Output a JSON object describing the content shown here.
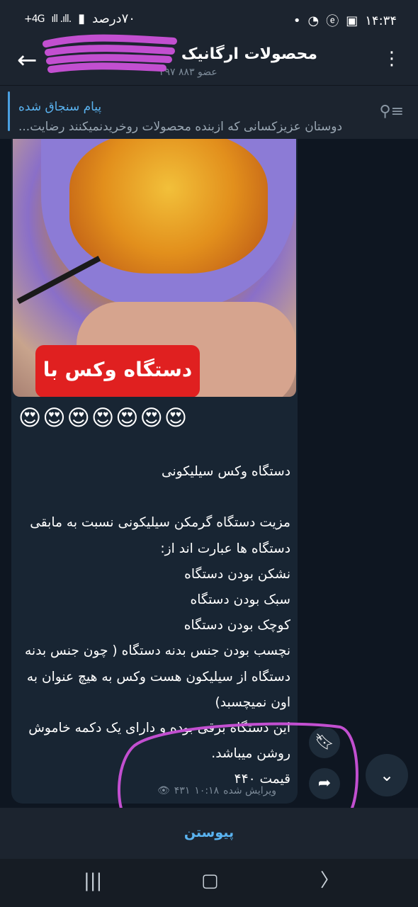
{
  "status_bar": {
    "time": "۱۴:۳۴",
    "battery": "۷۰درصد",
    "signal_label": "4G+"
  },
  "header": {
    "title": "محصولات ارگانیک",
    "subtitle": "۲۹۷ ۸۸۳ عضو"
  },
  "pinned": {
    "label": "پیام سنجاق شده",
    "text": "دوستان عزیزکسانی که ازبنده محصولات روخریدنمیکنند رضایت..."
  },
  "message": {
    "media_label": "دستگاه وکس با",
    "emojis": "😍😍😍😍😍😍😍",
    "text": "دستگاه وکس سیلیکونی\n\nمزیت دستگاه گرمکن سیلیکونی نسبت به مابقی دستگاه ها عبارت اند از:\nنشکن بودن دستگاه\nسبک بودن دستگاه\nکوچک بودن دستگاه\nنچسب بودن جنس بدنه دستگاه ( چون جنس بدنه دستگاه از سیلیکون هست وکس به هیچ عنوان به اون نمیچسبد)\nاین دستگاه برقی بوده و دارای یک دکمه خاموش روشن میباشد.\nقیمت ۴۴۰",
    "edited_label": "ویرایش شده",
    "time": "۱۰:۱۸",
    "views": "۴۳۱"
  },
  "bottom": {
    "join_label": "پیوستن"
  },
  "colors": {
    "bg": "#0e1621",
    "bar": "#1c242f",
    "bubble": "#182533",
    "accent": "#5ab3f0",
    "annotation": "#c24fd0"
  },
  "icons": [
    "back-arrow-icon",
    "kebab-menu-icon",
    "unpin-icon",
    "bookmark-icon",
    "share-icon",
    "chevron-down-icon",
    "eye-icon",
    "recents-icon",
    "home-icon",
    "nav-back-icon"
  ]
}
